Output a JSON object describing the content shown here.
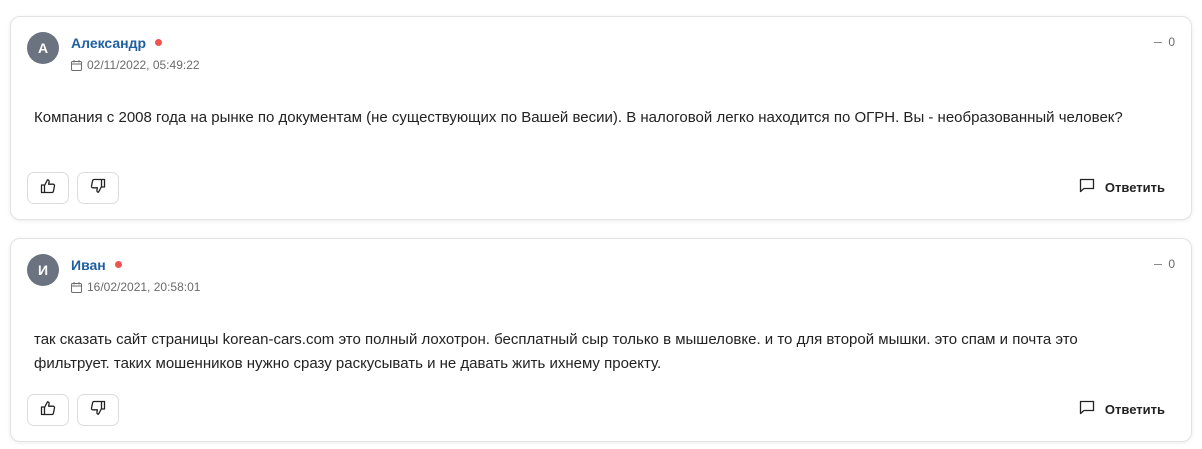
{
  "comments": [
    {
      "avatar_letter": "А",
      "author": "Александр",
      "date": "02/11/2022, 05:49:22",
      "rating": "0",
      "text": "Компания с 2008 года на рынке по документам (не существующих по Вашей весии). В налоговой легко находится по ОГРН. Вы - необразованный человек?",
      "reply_label": "Ответить"
    },
    {
      "avatar_letter": "И",
      "author": "Иван",
      "date": "16/02/2021, 20:58:01",
      "rating": "0",
      "text": "так сказать сайт страницы korean-cars.com это полный лохотрон. бесплатный сыр только в мышеловке. и то для второй мышки. это спам и почта это фильтрует. таких мошенников нужно сразу раскусывать и не давать жить ихнему проекту.",
      "reply_label": "Ответить"
    }
  ],
  "colors": {
    "author_name": "#1f5fa0",
    "online_dot": "#ef5350",
    "avatar_bg": "#6b7280"
  }
}
